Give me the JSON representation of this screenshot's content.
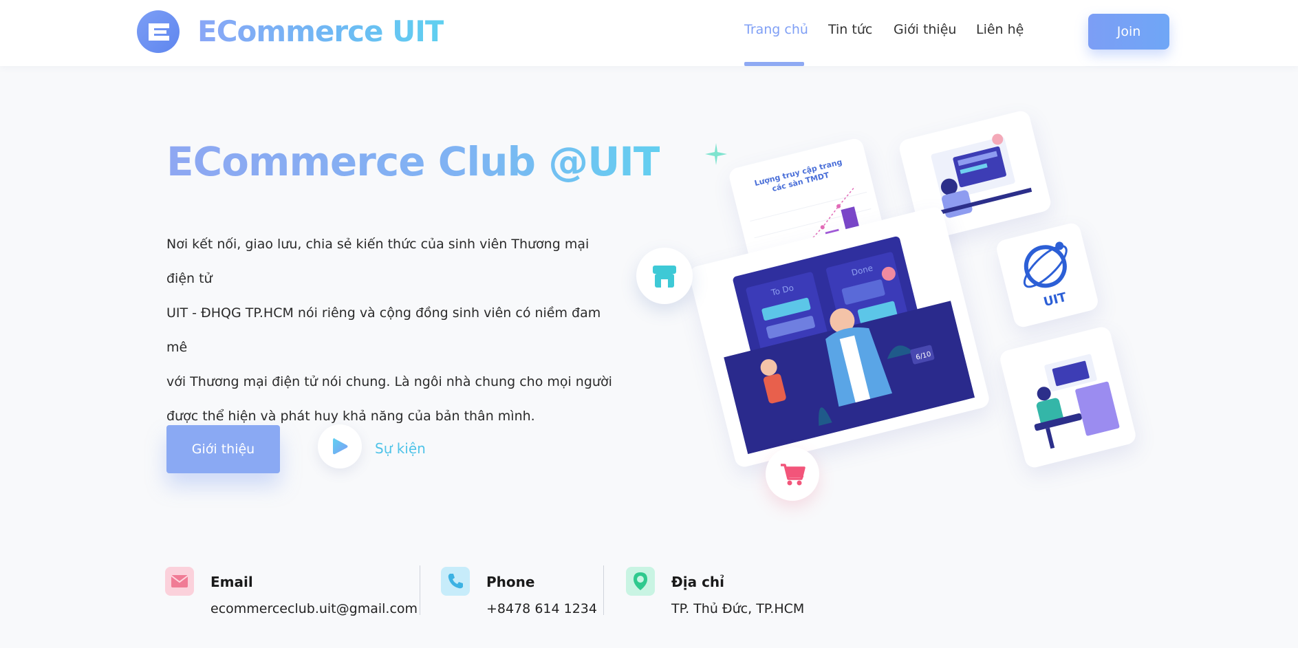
{
  "brand": {
    "name": "ECommerce UIT",
    "logo_letter": "E"
  },
  "nav": {
    "items": [
      {
        "label": "Trang chủ",
        "active": true
      },
      {
        "label": "Tin tức",
        "active": false
      },
      {
        "label": "Giới thiệu",
        "active": false
      },
      {
        "label": "Liên hệ",
        "active": false
      }
    ],
    "join_label": "Join"
  },
  "hero": {
    "title": "ECommerce Club @UIT",
    "description_lines": [
      "Nơi kết nối, giao lưu, chia sẻ kiến thức của sinh viên Thương mại điện tử",
      "UIT - ĐHQG TP.HCM nói riêng và cộng đồng sinh viên có niềm đam mê",
      "với Thương mại điện tử nói chung. Là ngôi nhà chung cho mọi người",
      "được thể hiện và phát huy khả năng của bản thân mình."
    ],
    "primary_button": "Giới thiệu",
    "event_link": "Sự kiện"
  },
  "illustration": {
    "chart_caption_line1": "Lượng truy cập trang",
    "chart_caption_line2": "các sàn TMDT",
    "uit_label": "UIT",
    "board_left": "To Do",
    "board_right": "Done",
    "badge": "6/10"
  },
  "contacts": [
    {
      "title": "Email",
      "value": "ecommerceclub.uit@gmail.com",
      "icon": "mail-icon",
      "color": "#f7b6c4"
    },
    {
      "title": "Phone",
      "value": "+8478 614 1234",
      "icon": "phone-icon",
      "color": "#bfe6f7"
    },
    {
      "title": "Địa chỉ",
      "value": "TP. Thủ Đức, TP.HCM",
      "icon": "location-pin-icon",
      "color": "#bff2dc"
    }
  ],
  "colors": {
    "accent": "#8aa9f3",
    "accent_cyan": "#4fc3e8",
    "background": "#f8f9fb"
  }
}
